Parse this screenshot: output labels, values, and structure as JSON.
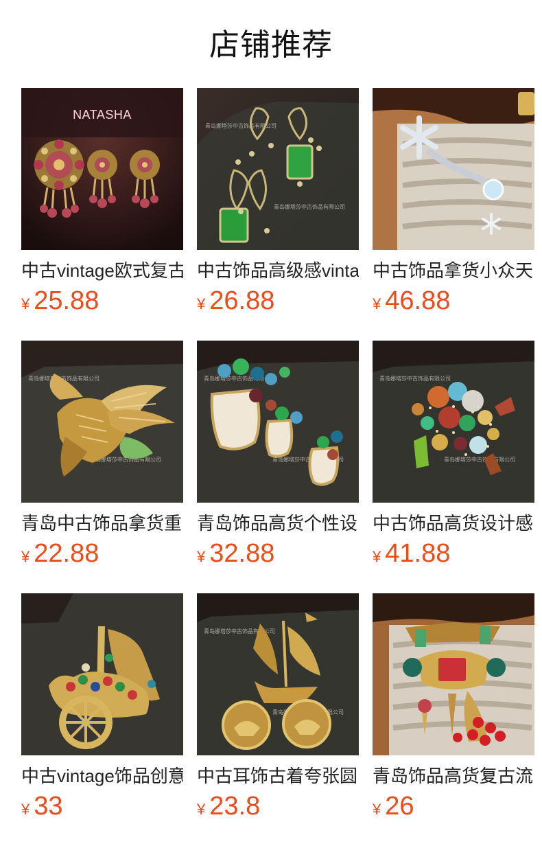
{
  "section": {
    "title": "店铺推荐"
  },
  "products": [
    {
      "title": "中古vintage欧式复古",
      "currency": "¥",
      "price": "25.88",
      "watermark": "NATASHA",
      "image": "jeweled-flower-brooch-and-earrings"
    },
    {
      "title": "中古饰品高级感vinta",
      "currency": "¥",
      "price": "26.88",
      "watermark": "青岛娜塔莎中古饰品有限公司",
      "image": "green-emerald-earrings-set"
    },
    {
      "title": "中古饰品拿货小众天",
      "currency": "¥",
      "price": "46.88",
      "watermark": "",
      "image": "snowflake-brooch-in-jewelry-box"
    },
    {
      "title": "青岛中古饰品拿货重",
      "currency": "¥",
      "price": "22.88",
      "watermark": "青岛娜塔莎中古饰品有限公司",
      "image": "gold-eagle-brooch"
    },
    {
      "title": "青岛饰品高货个性设",
      "currency": "¥",
      "price": "32.88",
      "watermark": "青岛娜塔莎中古饰品有限公司",
      "image": "flower-pot-brooch-and-earrings"
    },
    {
      "title": "中古饰品高货设计感",
      "currency": "¥",
      "price": "41.88",
      "watermark": "青岛娜塔莎中古饰品有限公司",
      "image": "colorful-charm-cluster-brooch"
    },
    {
      "title": "中古vintage饰品创意",
      "currency": "¥",
      "price": "33",
      "watermark": "",
      "image": "jeweled-cart-brooch"
    },
    {
      "title": "中古耳饰古着夸张圆",
      "currency": "¥",
      "price": "23.8",
      "watermark": "青岛娜塔莎中古饰品有限公司",
      "image": "sailing-ship-earrings"
    },
    {
      "title": "青岛饰品高货复古流",
      "currency": "¥",
      "price": "26",
      "watermark": "",
      "image": "red-tassel-pendant-brooch"
    }
  ]
}
